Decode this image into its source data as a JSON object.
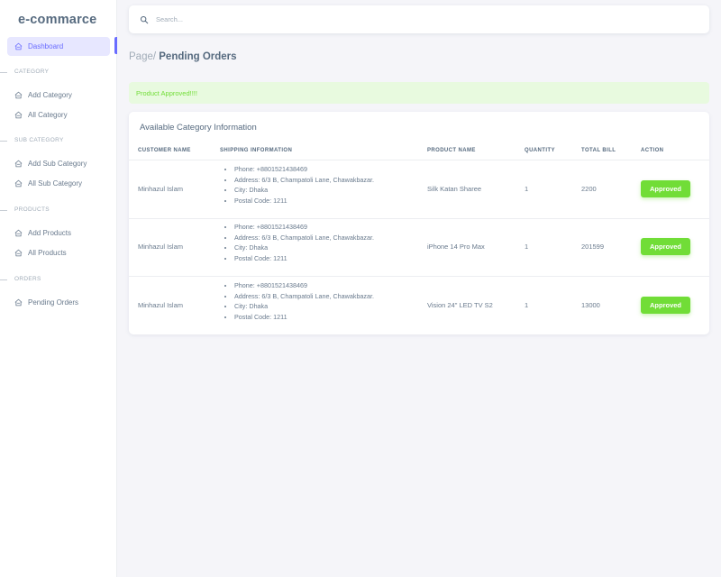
{
  "brand": "e-commarce",
  "sidebar": {
    "dashboard": "Dashboard",
    "sections": [
      {
        "title": "CATEGORY",
        "items": [
          "Add Category",
          "All Category"
        ]
      },
      {
        "title": "SUB CATEGORY",
        "items": [
          "Add Sub Category",
          "All Sub Category"
        ]
      },
      {
        "title": "PRODUCTS",
        "items": [
          "Add Products",
          "All Products"
        ]
      },
      {
        "title": "ORDERS",
        "items": [
          "Pending Orders"
        ]
      }
    ]
  },
  "search": {
    "placeholder": "Search..."
  },
  "breadcrumb": {
    "prefix": "Page/",
    "current": "Pending Orders"
  },
  "alert": "Product Approved!!!!",
  "card": {
    "title": "Available Category Information",
    "columns": [
      "CUSTOMER NAME",
      "SHIPPING INFORMATION",
      "PRODUCT NAME",
      "QUANTITY",
      "TOTAL BILL",
      "ACTION"
    ],
    "rows": [
      {
        "customer": "Minhazul Islam",
        "phone": "Phone: +8801521438469",
        "address": "Address: 6/3 B, Champatoli Lane, Chawakbazar.",
        "city": "City: Dhaka",
        "postal": "Postal Code: 1211",
        "product": "Silk Katan Sharee",
        "quantity": "1",
        "total": "2200",
        "action": "Approved"
      },
      {
        "customer": "Minhazul Islam",
        "phone": "Phone: +8801521438469",
        "address": "Address: 6/3 B, Champatoli Lane, Chawakbazar.",
        "city": "City: Dhaka",
        "postal": "Postal Code: 1211",
        "product": "iPhone 14 Pro Max",
        "quantity": "1",
        "total": "201599",
        "action": "Approved"
      },
      {
        "customer": "Minhazul Islam",
        "phone": "Phone: +8801521438469",
        "address": "Address: 6/3 B, Champatoli Lane, Chawakbazar.",
        "city": "City: Dhaka",
        "postal": "Postal Code: 1211",
        "product": "Vision 24\" LED TV S2",
        "quantity": "1",
        "total": "13000",
        "action": "Approved"
      }
    ]
  },
  "colors": {
    "accent": "#696cff",
    "success": "#71dd37",
    "success_bg": "#e8fadf",
    "background": "#f5f5f9"
  }
}
